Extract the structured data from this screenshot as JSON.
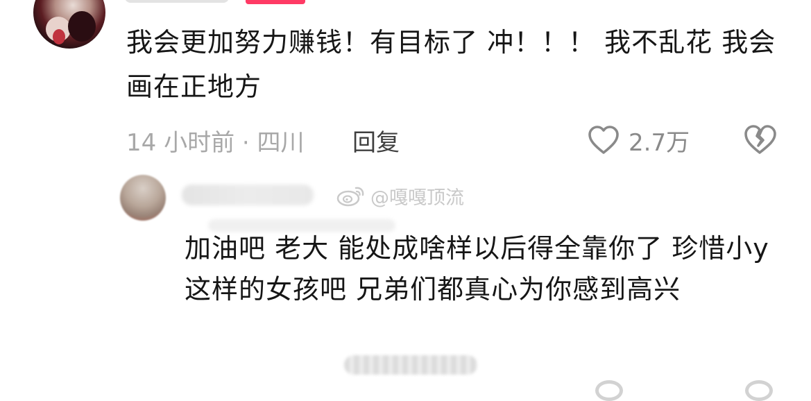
{
  "comment": {
    "text": "我会更加努力赚钱！有目标了 冲！！！ 我不乱花 我会画在正地方",
    "time": "14 小时前 · 四川",
    "reply_label": "回复",
    "like_count": "2.7万",
    "like_icon": "heart-outline-icon",
    "dislike_icon": "broken-heart-icon",
    "author_tag_color": "#ff3a65"
  },
  "reply": {
    "text": "加油吧 老大 能处成啥样以后得全靠你了 珍惜小y这样的女孩吧 兄弟们都真心为你感到高兴"
  },
  "watermark": {
    "text": "@嘎嘎顶流",
    "icon": "weibo-logo-icon"
  }
}
